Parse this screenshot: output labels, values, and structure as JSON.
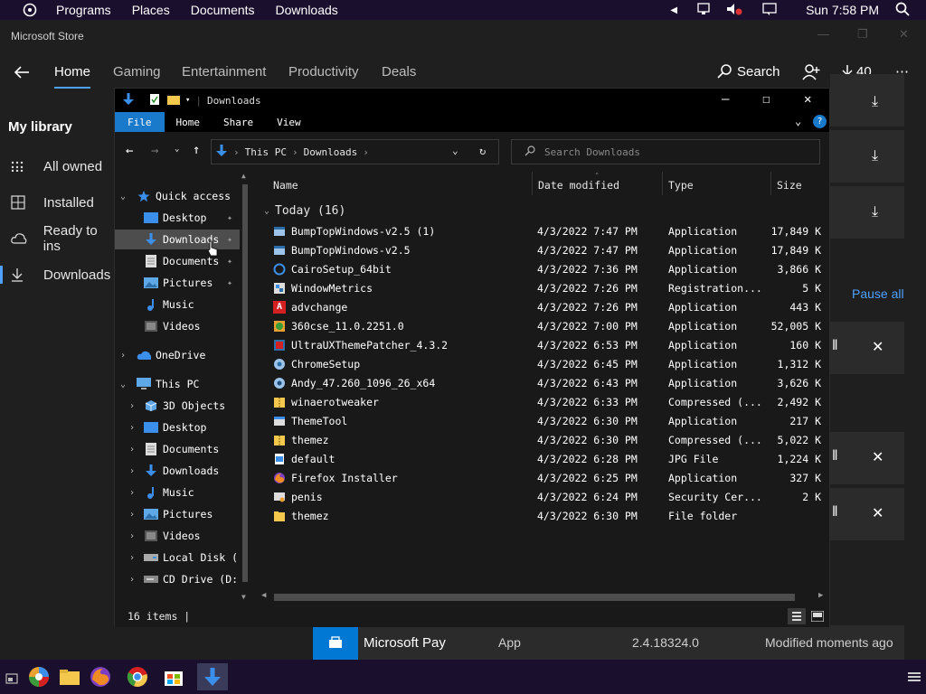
{
  "panel": {
    "menus": [
      "Programs",
      "Places",
      "Documents",
      "Downloads"
    ],
    "clock": "Sun 7:58 PM"
  },
  "store": {
    "title": "Microsoft Store",
    "nav_tabs": [
      "Home",
      "Gaming",
      "Entertainment",
      "Productivity",
      "Deals"
    ],
    "search_label": "Search",
    "downloads_count": "40",
    "library_title": "My library",
    "library_items": [
      "All owned",
      "Installed",
      "Ready to ins",
      "Downloads"
    ],
    "pause_all": "Pause all",
    "pay_row": {
      "name": "Microsoft Pay",
      "type": "App",
      "version": "2.4.18324.0",
      "status": "Modified moments ago"
    }
  },
  "explorer": {
    "title": "Downloads",
    "ribbon": [
      "File",
      "Home",
      "Share",
      "View"
    ],
    "address": [
      "This PC",
      "Downloads"
    ],
    "search_placeholder": "Search Downloads",
    "nav": {
      "quick_access": "Quick access",
      "quick_items": [
        "Desktop",
        "Downloads",
        "Documents",
        "Pictures",
        "Music",
        "Videos"
      ],
      "onedrive": "OneDrive",
      "this_pc": "This PC",
      "pc_items": [
        "3D Objects",
        "Desktop",
        "Documents",
        "Downloads",
        "Music",
        "Pictures",
        "Videos",
        "Local Disk (",
        "CD Drive (D:"
      ]
    },
    "columns": [
      "Name",
      "Date modified",
      "Type",
      "Size"
    ],
    "group": "Today (16)",
    "files": [
      {
        "name": "BumpTopWindows-v2.5 (1)",
        "date": "4/3/2022 7:47 PM",
        "type": "Application",
        "size": "17,849 K"
      },
      {
        "name": "BumpTopWindows-v2.5",
        "date": "4/3/2022 7:47 PM",
        "type": "Application",
        "size": "17,849 K"
      },
      {
        "name": "CairoSetup_64bit",
        "date": "4/3/2022 7:36 PM",
        "type": "Application",
        "size": "3,866 K"
      },
      {
        "name": "WindowMetrics",
        "date": "4/3/2022 7:26 PM",
        "type": "Registration...",
        "size": "5 K"
      },
      {
        "name": "advchange",
        "date": "4/3/2022 7:26 PM",
        "type": "Application",
        "size": "443 K"
      },
      {
        "name": "360cse_11.0.2251.0",
        "date": "4/3/2022 7:00 PM",
        "type": "Application",
        "size": "52,005 K"
      },
      {
        "name": "UltraUXThemePatcher_4.3.2",
        "date": "4/3/2022 6:53 PM",
        "type": "Application",
        "size": "160 K"
      },
      {
        "name": "ChromeSetup",
        "date": "4/3/2022 6:45 PM",
        "type": "Application",
        "size": "1,312 K"
      },
      {
        "name": "Andy_47.260_1096_26_x64",
        "date": "4/3/2022 6:43 PM",
        "type": "Application",
        "size": "3,626 K"
      },
      {
        "name": "winaerotweaker",
        "date": "4/3/2022 6:33 PM",
        "type": "Compressed (...",
        "size": "2,492 K"
      },
      {
        "name": "ThemeTool",
        "date": "4/3/2022 6:30 PM",
        "type": "Application",
        "size": "217 K"
      },
      {
        "name": "themez",
        "date": "4/3/2022 6:30 PM",
        "type": "Compressed (...",
        "size": "5,022 K"
      },
      {
        "name": "default",
        "date": "4/3/2022 6:28 PM",
        "type": "JPG File",
        "size": "1,224 K"
      },
      {
        "name": "Firefox Installer",
        "date": "4/3/2022 6:25 PM",
        "type": "Application",
        "size": "327 K"
      },
      {
        "name": "penis",
        "date": "4/3/2022 6:24 PM",
        "type": "Security Cer...",
        "size": "2 K"
      },
      {
        "name": "themez",
        "date": "4/3/2022 6:30 PM",
        "type": "File folder",
        "size": ""
      }
    ],
    "status": "16 items |"
  }
}
